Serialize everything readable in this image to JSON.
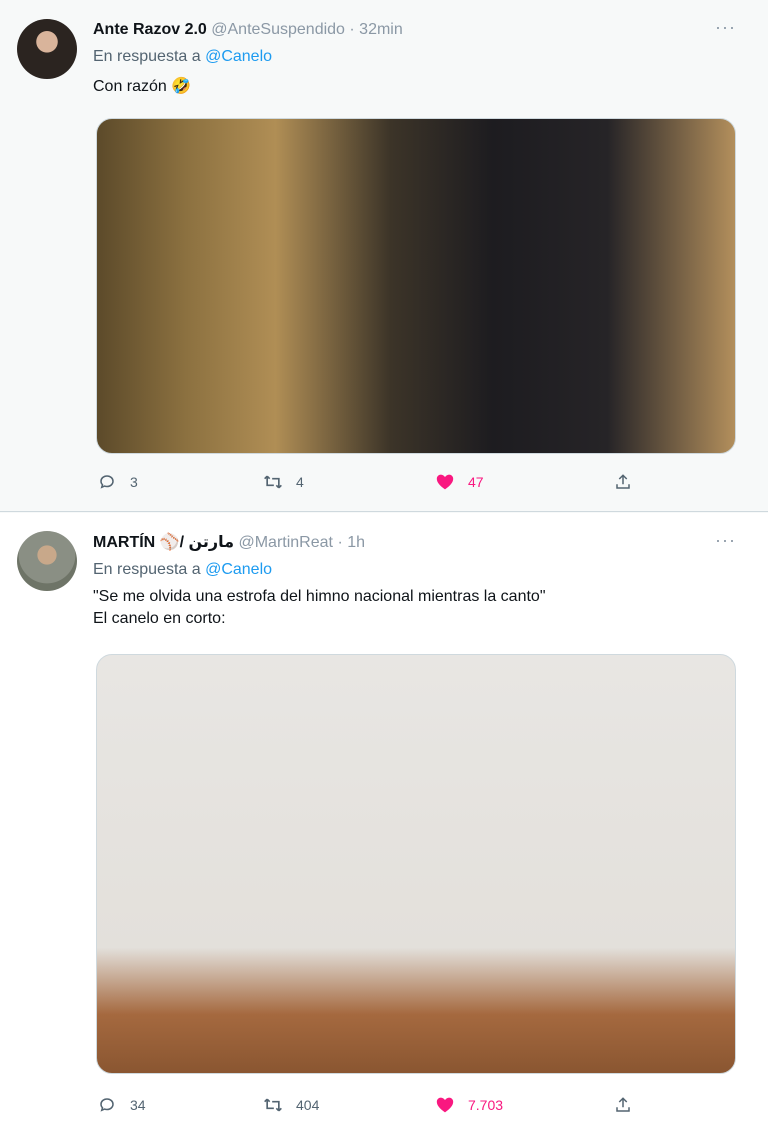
{
  "tweets": [
    {
      "author": {
        "name": "Ante Razov 2.0",
        "handle": "@AnteSuspendido",
        "time": "· 32min",
        "avatar_icon": "avatar-photo"
      },
      "more_label": "···",
      "replying": {
        "prefix": "En respuesta a",
        "mention": "@Canelo"
      },
      "text": "Con razón 🤣",
      "media": {
        "alt_icon": "photo"
      },
      "stats": {
        "replies": "3",
        "retweets": "4",
        "likes": "47"
      },
      "icons": {
        "reply": "comment-icon",
        "retweet": "retweet-icon",
        "like": "heart-icon",
        "share": "share-icon"
      }
    },
    {
      "author": {
        "name": "MARTÍN",
        "handle_rtl": "مارتن",
        "handle": "@MartinReat",
        "time": "· 1h",
        "avatar_icon": "avatar-photo"
      },
      "more_label": "···",
      "replying": {
        "prefix": "En respuesta a",
        "mention": "@Canelo"
      },
      "text": "\"Se me olvida una estrofa del himno nacional mientras la canto\"\nEl canelo en corto:",
      "media": {
        "alt_icon": "photo"
      },
      "stats": {
        "replies": "34",
        "retweets": "404",
        "likes": "7.703"
      },
      "icons": {
        "reply": "comment-icon",
        "retweet": "retweet-icon",
        "like": "heart-icon",
        "share": "share-icon"
      }
    }
  ],
  "colors": {
    "like": "#f91880",
    "mention": "#1d9bf0",
    "muted": "#536471",
    "handle": "#8b98a5"
  }
}
